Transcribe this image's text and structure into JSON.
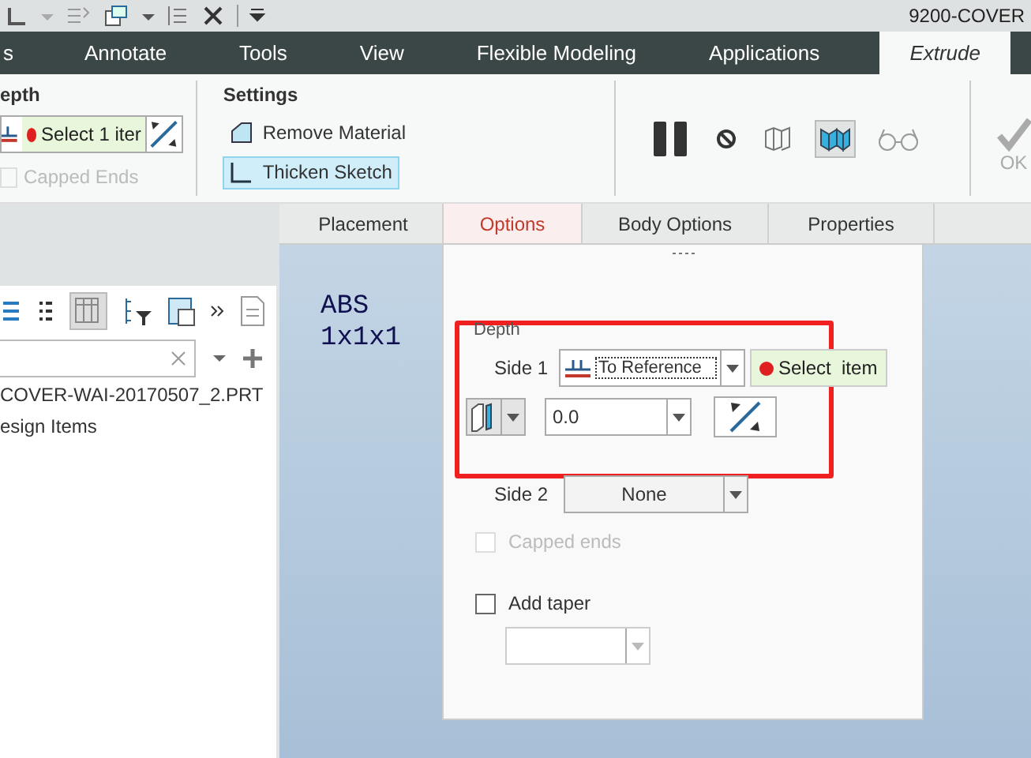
{
  "window": {
    "title": "9200-COVER"
  },
  "tabs": [
    {
      "label": "s",
      "selected": false
    },
    {
      "label": "Annotate",
      "selected": false
    },
    {
      "label": "Tools",
      "selected": false
    },
    {
      "label": "View",
      "selected": false
    },
    {
      "label": "Flexible Modeling",
      "selected": false
    },
    {
      "label": "Applications",
      "selected": false
    },
    {
      "label": "Extrude",
      "selected": true
    }
  ],
  "ribbon": {
    "depth": {
      "label": "epth",
      "select": "Select 1 iter",
      "capped_ends": {
        "label": "Capped Ends",
        "disabled": true
      }
    },
    "settings": {
      "label": "Settings",
      "options": [
        {
          "label": "Remove Material",
          "selected": false,
          "kind": "remove"
        },
        {
          "label": "Thicken Sketch",
          "selected": true,
          "kind": "thicken"
        }
      ]
    },
    "tools": [
      {
        "kind": "pause",
        "selected": false
      },
      {
        "kind": "no",
        "selected": false
      },
      {
        "kind": "verify",
        "selected": false
      },
      {
        "kind": "preview",
        "selected": true
      },
      {
        "kind": "glasses",
        "selected": false
      }
    ],
    "ok": {
      "label": "OK",
      "disabled": true
    }
  },
  "dashboard_tabs": [
    {
      "label": "Placement",
      "selected": false
    },
    {
      "label": "Options",
      "selected": true
    },
    {
      "label": "Body Options",
      "selected": false
    },
    {
      "label": "Properties",
      "selected": false
    }
  ],
  "model_tree": {
    "items": [
      "COVER-WAI-20170507_2.PRT",
      "esign Items"
    ]
  },
  "graphics": {
    "note": [
      "ABS",
      "1x1x1"
    ]
  },
  "options": {
    "depth_label": "Depth",
    "side1": {
      "label": "Side 1",
      "value": "To Reference",
      "select": "Select  item"
    },
    "depth_value": "0.0",
    "side2": {
      "label": "Side 2",
      "value": "None"
    },
    "capped_ends": {
      "label": "Capped ends",
      "checked": false,
      "disabled": true
    },
    "add_taper": {
      "label": "Add taper",
      "checked": false
    }
  }
}
